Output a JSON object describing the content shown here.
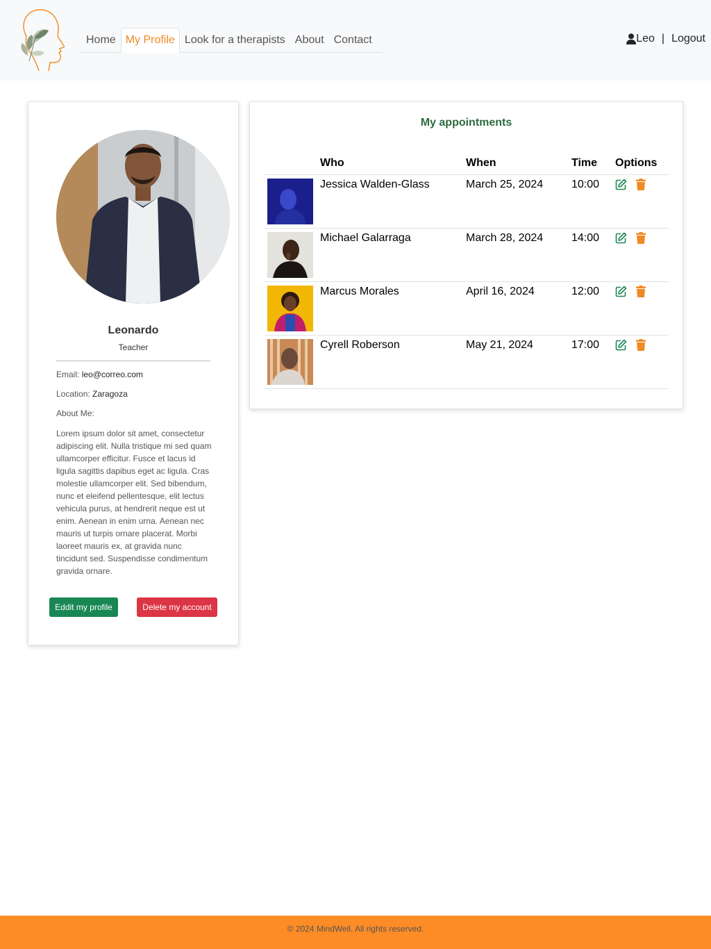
{
  "nav": {
    "items": [
      {
        "label": "Home",
        "active": false
      },
      {
        "label": "My Profile",
        "active": true
      },
      {
        "label": "Look for a therapists",
        "active": false
      },
      {
        "label": "About",
        "active": false
      },
      {
        "label": "Contact",
        "active": false
      }
    ]
  },
  "user": {
    "name": "Leo",
    "separator": "|",
    "logout": "Logout",
    "icon": "user-icon"
  },
  "profile": {
    "name": "Leonardo",
    "role": "Teacher",
    "email_label": "Email:",
    "email": "leo@correo.com",
    "location_label": "Location:",
    "location": "Zaragoza",
    "about_label": "About Me:",
    "about": "Lorem ipsum dolor sit amet, consectetur adipiscing elit. Nulla tristique mi sed quam ullamcorper efficitur. Fusce et lacus id ligula sagittis dapibus eget ac ligula. Cras molestie ullamcorper elit. Sed bibendum, nunc et eleifend pellentesque, elit lectus vehicula purus, at hendrerit neque est ut enim. Aenean in enim urna. Aenean nec mauris ut turpis ornare placerat. Morbi laoreet mauris ex, at gravida nunc tincidunt sed. Suspendisse condimentum gravida ornare.",
    "edit_button": "Eddit my profile",
    "delete_button": "Delete my account"
  },
  "appointments": {
    "title": "My appointments",
    "headers": {
      "who": "Who",
      "when": "When",
      "time": "Time",
      "options": "Options"
    },
    "rows": [
      {
        "who": "Jessica Walden-Glass",
        "when": "March 25, 2024",
        "time": "10:00"
      },
      {
        "who": "Michael Galarraga",
        "when": "March 28, 2024",
        "time": "14:00"
      },
      {
        "who": "Marcus Morales",
        "when": "April 16, 2024",
        "time": "12:00"
      },
      {
        "who": "Cyrell Roberson",
        "when": "May 21, 2024",
        "time": "17:00"
      }
    ]
  },
  "colors": {
    "accent": "#f08a24",
    "footer": "#fd8c26",
    "edit_green": "#198754",
    "delete_red": "#dc3545",
    "title_green": "#2e6b3f"
  },
  "footer": {
    "text": "© 2024 MindWell. All rights reserved."
  }
}
